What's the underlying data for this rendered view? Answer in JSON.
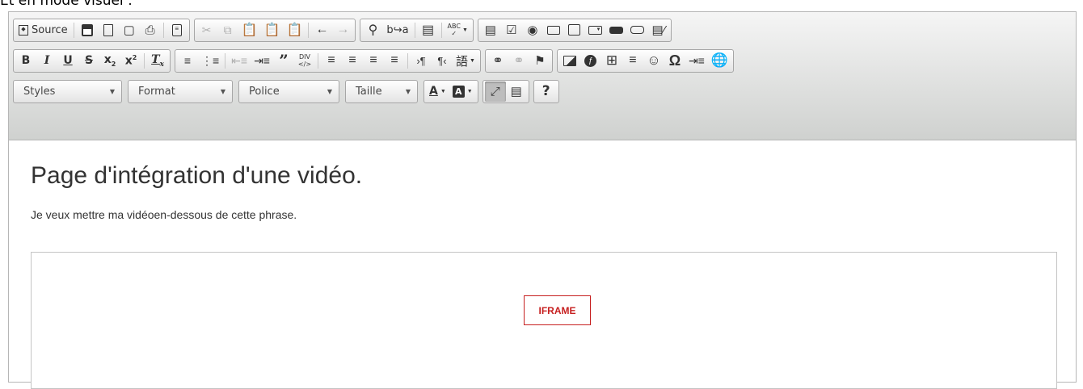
{
  "caption": "Et en mode visuel :",
  "toolbar": {
    "source_label": "Source",
    "styles_label": "Styles",
    "format_label": "Format",
    "font_label": "Police",
    "size_label": "Taille",
    "help_label": "?",
    "abc_label": "ABC",
    "div_label": "DIV"
  },
  "content": {
    "heading": "Page d'intégration d'une vidéo.",
    "paragraph": "Je veux mettre ma vidéoen-dessous de cette phrase.",
    "iframe_label": "IFRAME"
  },
  "colors": {
    "iframe_badge": "#c61f1f",
    "toolbar_bg_top": "#f5f5f5",
    "toolbar_bg_bottom": "#cfd1cf"
  }
}
